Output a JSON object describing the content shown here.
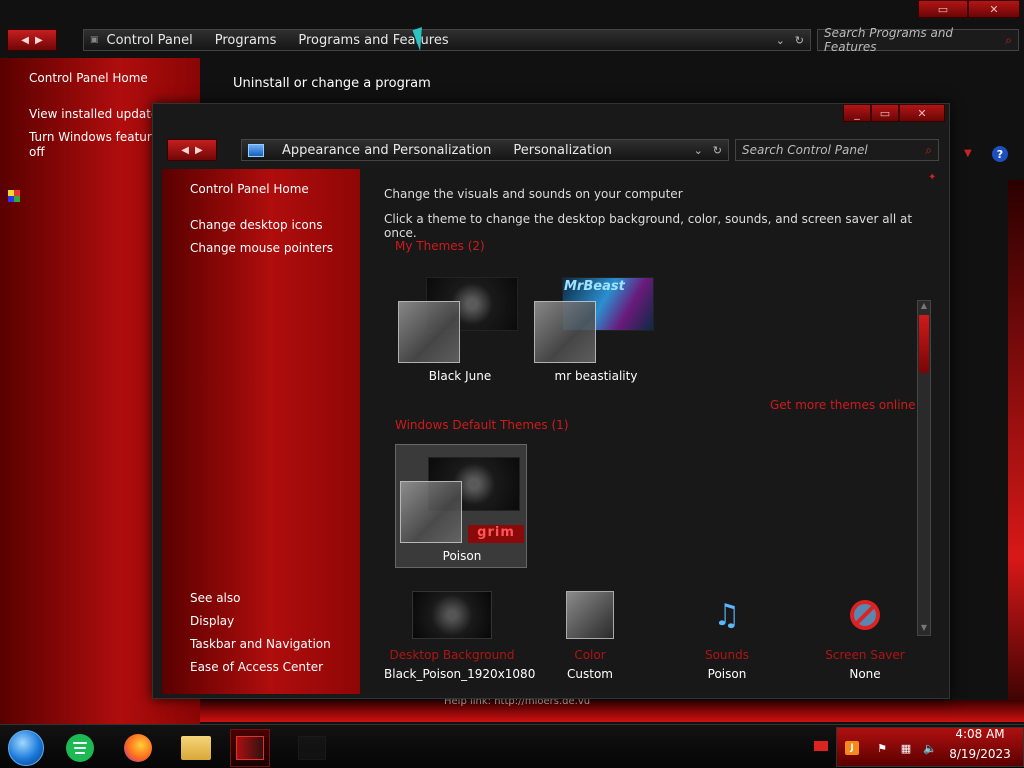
{
  "back_window": {
    "breadcrumbs": [
      "Control Panel",
      "Programs",
      "Programs and Features"
    ],
    "search_placeholder": "Search Programs and Features",
    "sidebar": {
      "home": "Control Panel Home",
      "updates": "View installed updates",
      "features_line1": "Turn Windows features",
      "features_line2": "off"
    },
    "main_title": "Uninstall or change a program",
    "footer_help": "Help link:     http://mioers.de.vu"
  },
  "front_window": {
    "breadcrumbs": [
      "Appearance and Personalization",
      "Personalization"
    ],
    "search_placeholder": "Search Control Panel",
    "sidebar": {
      "home": "Control Panel Home",
      "desktop_icons": "Change desktop icons",
      "mouse_pointers": "Change mouse pointers",
      "see_also": "See also",
      "display": "Display",
      "taskbar": "Taskbar and Navigation",
      "ease": "Ease of Access Center"
    },
    "content": {
      "heading": "Change the visuals and sounds on your computer",
      "subheading": "Click a theme to change the desktop background, color, sounds, and screen saver all at once.",
      "my_themes_title": "My Themes (2)",
      "default_themes_title": "Windows Default Themes (1)",
      "get_more": "Get more themes online",
      "themes": {
        "black_june": "Black June",
        "mr_beastiality": "mr beastiality",
        "poison": "Poison"
      },
      "theme_thumb_text": {
        "beast": "MrBeast",
        "grim": "grim"
      },
      "settings": [
        {
          "label": "Desktop Background",
          "value": "Black_Poison_1920x1080"
        },
        {
          "label": "Color",
          "value": "Custom"
        },
        {
          "label": "Sounds",
          "value": "Poison"
        },
        {
          "label": "Screen Saver",
          "value": "None"
        }
      ]
    }
  },
  "taskbar": {
    "time": "4:08 AM",
    "date": "8/19/2023",
    "tray_icons": [
      "java-icon",
      "flag-icon",
      "network-icon",
      "volume-icon"
    ]
  },
  "colors": {
    "accent_red": "#d01a1a",
    "sidebar_red": "#b00d0d",
    "window_bg": "#191919"
  }
}
